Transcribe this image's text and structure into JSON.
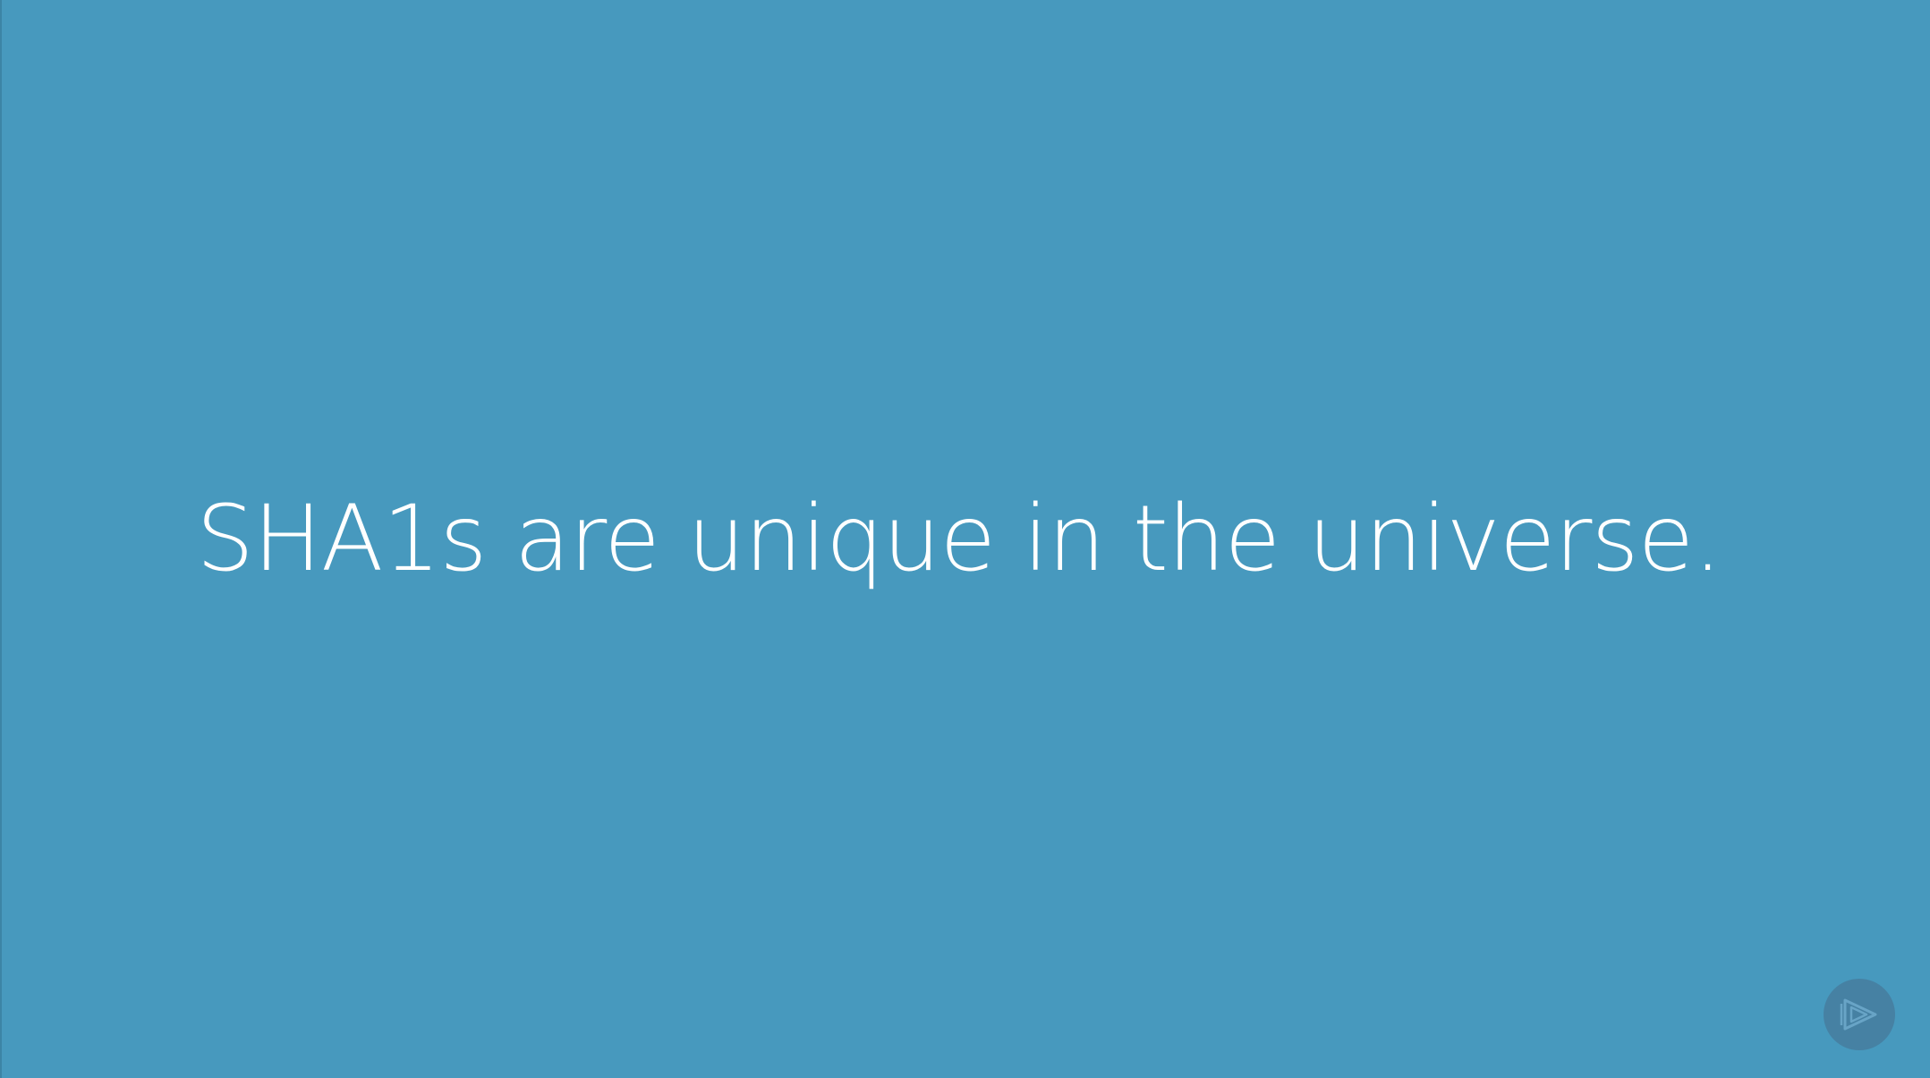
{
  "slide": {
    "statement": "SHA1s are unique in the universe.",
    "background_color": "#4799be",
    "text_color": "#ffffff"
  },
  "watermark": {
    "icon": "play-logo-icon"
  }
}
